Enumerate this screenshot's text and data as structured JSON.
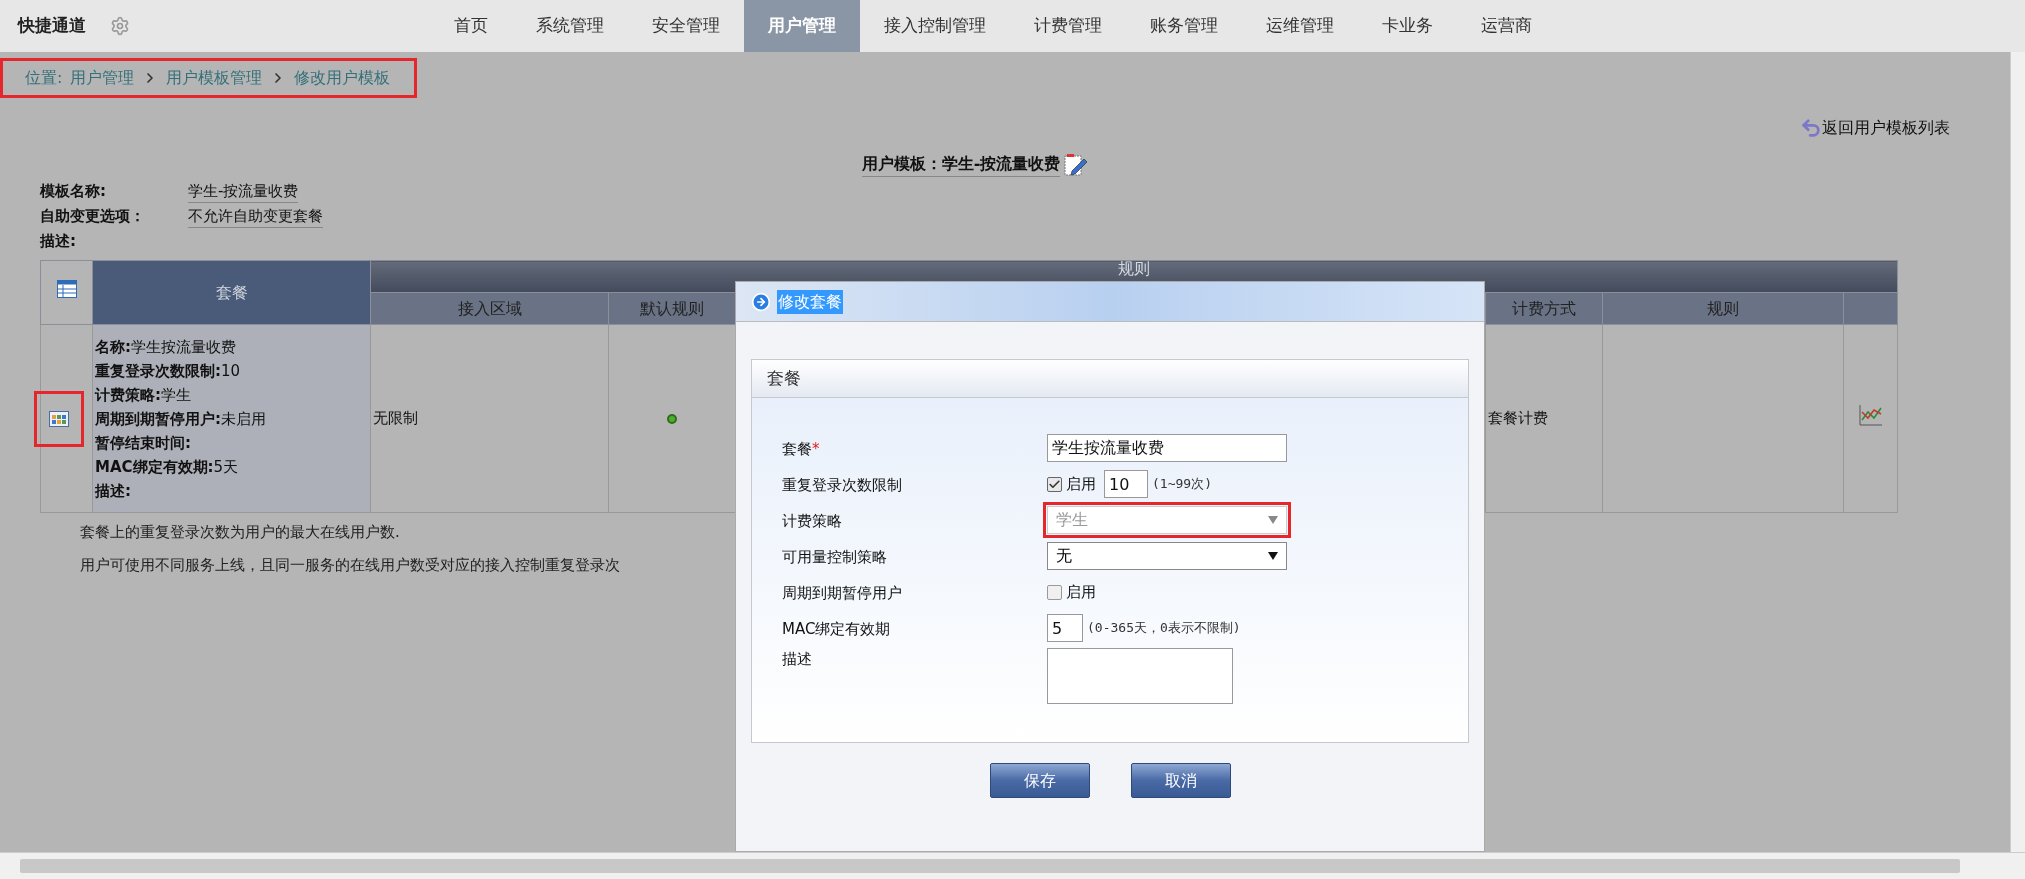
{
  "nav": {
    "brand": "快捷通道",
    "items": [
      {
        "label": "首页",
        "selected": false
      },
      {
        "label": "系统管理",
        "selected": false
      },
      {
        "label": "安全管理",
        "selected": false
      },
      {
        "label": "用户管理",
        "selected": true
      },
      {
        "label": "接入控制管理",
        "selected": false
      },
      {
        "label": "计费管理",
        "selected": false
      },
      {
        "label": "账务管理",
        "selected": false
      },
      {
        "label": "运维管理",
        "selected": false
      },
      {
        "label": "卡业务",
        "selected": false
      },
      {
        "label": "运营商",
        "selected": false
      }
    ]
  },
  "breadcrumb": {
    "label": "位置:",
    "items": [
      "用户管理",
      "用户模板管理",
      "修改用户模板"
    ],
    "highlighted": true
  },
  "back_link": "返回用户模板列表",
  "title": {
    "label": "用户模板：",
    "value": "学生-按流量收费"
  },
  "info": [
    {
      "label": "模板名称:",
      "value": "学生-按流量收费"
    },
    {
      "label": "自助变更选项：",
      "value": "不允许自助变更套餐"
    },
    {
      "label": "描述:"
    }
  ],
  "table": {
    "package_header": "套餐",
    "rules_header": "规则",
    "columns": [
      "接入区域",
      "默认规则",
      "计费方式",
      "规则"
    ],
    "row": {
      "icon_highlighted": true,
      "package_lines": [
        {
          "label": "名称:",
          "value": "学生按流量收费"
        },
        {
          "label": "重复登录次数限制:",
          "value": "10"
        },
        {
          "label": "计费策略:",
          "value": "学生"
        },
        {
          "label": "周期到期暂停用户:",
          "value": "未启用"
        },
        {
          "label": "暂停结束时间:"
        },
        {
          "label": "MAC绑定有效期:",
          "value": "5天"
        },
        {
          "label": "描述:"
        }
      ],
      "access_area": "无限制",
      "default_rule": true,
      "billing_method": "套餐计费"
    }
  },
  "notes": [
    "套餐上的重复登录次数为用户的最大在线用户数.",
    "用户可使用不同服务上线，且同一服务的在线用户数受对应的接入控制重复登录次"
  ],
  "dialog": {
    "title": "修改套餐",
    "section": "套餐",
    "fields": [
      {
        "kind": "text",
        "label": "套餐",
        "required_mark": "*",
        "value": "学生按流量收费"
      },
      {
        "kind": "limit",
        "label": "重复登录次数限制",
        "checked": true,
        "check_label": "启用",
        "value": "10",
        "hint": "(1~99次)"
      },
      {
        "kind": "select",
        "label": "计费策略",
        "value": "学生",
        "disabled": true,
        "highlighted": true
      },
      {
        "kind": "select",
        "label": "可用量控制策略",
        "value": "无",
        "disabled": false,
        "highlighted": false
      },
      {
        "kind": "checkbox",
        "label": "周期到期暂停用户",
        "checked": false,
        "check_label": "启用"
      },
      {
        "kind": "number",
        "label": "MAC绑定有效期",
        "value": "5",
        "hint": "(0-365天，0表示不限制)"
      },
      {
        "kind": "textarea",
        "label": "描述"
      }
    ],
    "buttons": [
      "保存",
      "取消"
    ]
  }
}
